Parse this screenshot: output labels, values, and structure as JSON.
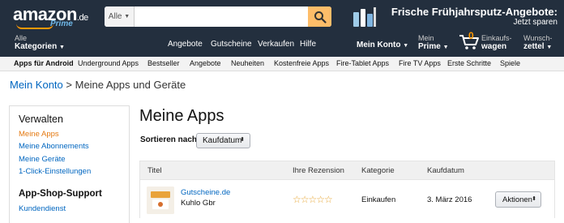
{
  "header": {
    "logo_text": "amazon",
    "logo_suffix": ".de",
    "logo_prime": "Prime",
    "search": {
      "category": "Alle",
      "value": "",
      "placeholder": ""
    },
    "promo": {
      "line1": "Frische Frühjahrsputz-Angebote:",
      "line2": "Jetzt sparen"
    },
    "nav": {
      "alle_small": "Alle",
      "alle_big": "Kategorien",
      "links": [
        "Angebote",
        "Gutscheine",
        "Verkaufen",
        "Hilfe"
      ],
      "mein_konto": "Mein Konto",
      "mein_prime_small": "Mein",
      "mein_prime_big": "Prime",
      "cart_count": "0",
      "cart_small": "Einkaufs-",
      "cart_big": "wagen",
      "wish_small": "Wunsch-",
      "wish_big": "zettel"
    }
  },
  "subnav": {
    "items": [
      "Apps für Android",
      "Underground Apps",
      "Bestseller",
      "Angebote",
      "Neuheiten",
      "Kostenfreie Apps",
      "Fire-Tablet Apps",
      "Fire TV Apps",
      "Erste Schritte",
      "Spiele"
    ]
  },
  "breadcrumb": {
    "root": "Mein Konto",
    "sep": ">",
    "current": "Meine Apps und Geräte"
  },
  "sidebar": {
    "heading1": "Verwalten",
    "links1": [
      "Meine Apps",
      "Meine Abonnements",
      "Meine Geräte",
      "1-Click-Einstellungen"
    ],
    "heading2": "App-Shop-Support",
    "links2": [
      "Kundendienst"
    ]
  },
  "main": {
    "title": "Meine Apps",
    "sort_label": "Sortieren nach",
    "sort_value": "Kaufdatum",
    "columns": [
      "Titel",
      "Ihre Rezension",
      "Kategorie",
      "Kaufdatum"
    ],
    "rows": [
      {
        "name": "Gutscheine.de",
        "developer": "Kuhlo Gbr",
        "rating": "☆☆☆☆☆",
        "category": "Einkaufen",
        "date": "3. März 2016",
        "action": "Aktionen"
      }
    ]
  },
  "colors": {
    "header_bg": "#232f3e",
    "link": "#0066c0",
    "active": "#e47911",
    "search_btn": "#febd69"
  }
}
